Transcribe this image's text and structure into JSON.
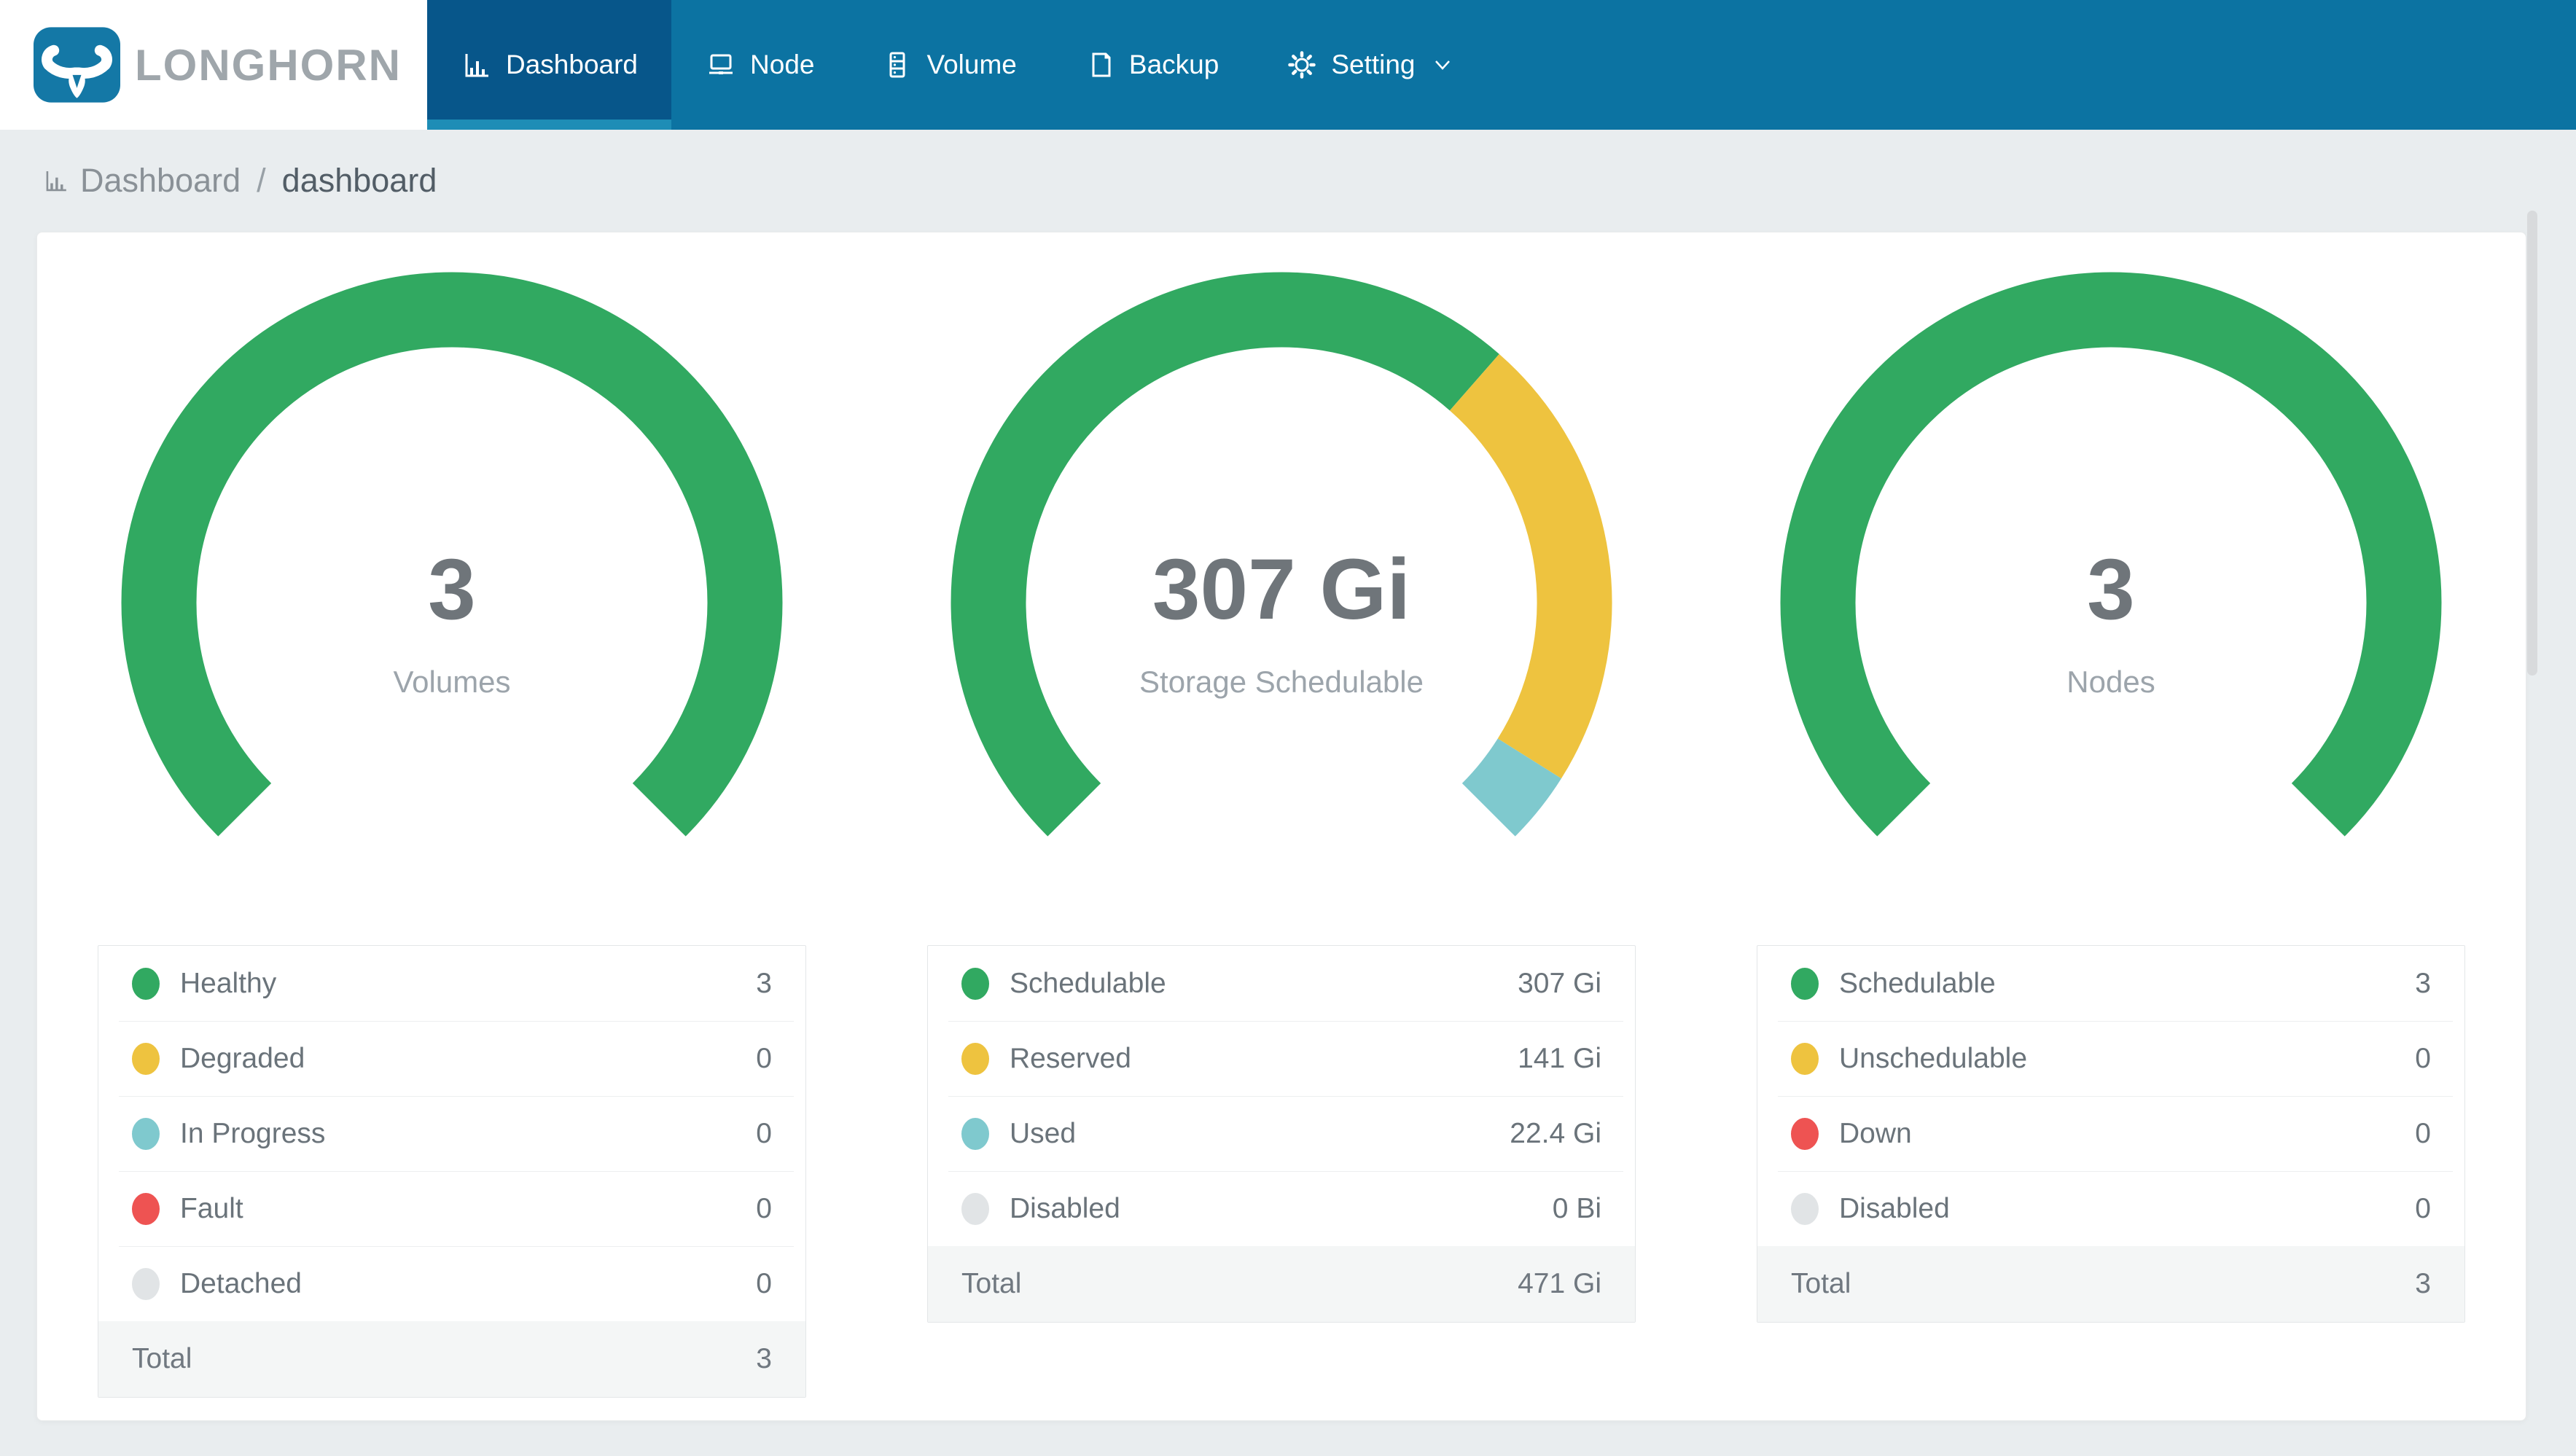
{
  "app": {
    "name": "LONGHORN"
  },
  "colors": {
    "green": "#31A961",
    "yellow": "#EEC33F",
    "teal": "#7FC9CE",
    "red": "#EE5352",
    "gray": "#E1E4E6",
    "nav_bg": "#0C73A2",
    "nav_active": "#07568A",
    "nav_active_underline": "#1E8DB6",
    "logo_blue": "#1478A6",
    "page_bg": "#E9EDEF"
  },
  "nav": {
    "items": [
      {
        "label": "Dashboard",
        "icon": "bar-chart-icon",
        "active": true
      },
      {
        "label": "Node",
        "icon": "node-icon",
        "active": false
      },
      {
        "label": "Volume",
        "icon": "volume-icon",
        "active": false
      },
      {
        "label": "Backup",
        "icon": "backup-icon",
        "active": false
      },
      {
        "label": "Setting",
        "icon": "gear-icon",
        "active": false,
        "has_dropdown": true
      }
    ]
  },
  "breadcrumb": {
    "section": "Dashboard",
    "separator": "/",
    "page": "dashboard"
  },
  "gauges": [
    {
      "title": "Volumes",
      "center_value": "3",
      "center_label": "Volumes",
      "segments": [
        {
          "label": "Healthy",
          "color_key": "green",
          "value": 3
        }
      ]
    },
    {
      "title": "Storage Schedulable",
      "center_value": "307 Gi",
      "center_label": "Storage Schedulable",
      "segments": [
        {
          "label": "Schedulable",
          "color_key": "green",
          "value": 307
        },
        {
          "label": "Reserved",
          "color_key": "yellow",
          "value": 141
        },
        {
          "label": "Used",
          "color_key": "teal",
          "value": 22.4
        },
        {
          "label": "Disabled",
          "color_key": "gray",
          "value": 0
        }
      ]
    },
    {
      "title": "Nodes",
      "center_value": "3",
      "center_label": "Nodes",
      "segments": [
        {
          "label": "Schedulable",
          "color_key": "green",
          "value": 3
        }
      ]
    }
  ],
  "legends": [
    {
      "rows": [
        {
          "label": "Healthy",
          "color_key": "green",
          "value": "3"
        },
        {
          "label": "Degraded",
          "color_key": "yellow",
          "value": "0"
        },
        {
          "label": "In Progress",
          "color_key": "teal",
          "value": "0"
        },
        {
          "label": "Fault",
          "color_key": "red",
          "value": "0"
        },
        {
          "label": "Detached",
          "color_key": "gray",
          "value": "0"
        }
      ],
      "total": {
        "label": "Total",
        "value": "3"
      }
    },
    {
      "rows": [
        {
          "label": "Schedulable",
          "color_key": "green",
          "value": "307 Gi"
        },
        {
          "label": "Reserved",
          "color_key": "yellow",
          "value": "141 Gi"
        },
        {
          "label": "Used",
          "color_key": "teal",
          "value": "22.4 Gi"
        },
        {
          "label": "Disabled",
          "color_key": "gray",
          "value": "0 Bi"
        }
      ],
      "total": {
        "label": "Total",
        "value": "471 Gi"
      }
    },
    {
      "rows": [
        {
          "label": "Schedulable",
          "color_key": "green",
          "value": "3"
        },
        {
          "label": "Unschedulable",
          "color_key": "yellow",
          "value": "0"
        },
        {
          "label": "Down",
          "color_key": "red",
          "value": "0"
        },
        {
          "label": "Disabled",
          "color_key": "gray",
          "value": "0"
        }
      ],
      "total": {
        "label": "Total",
        "value": "3"
      }
    }
  ]
}
